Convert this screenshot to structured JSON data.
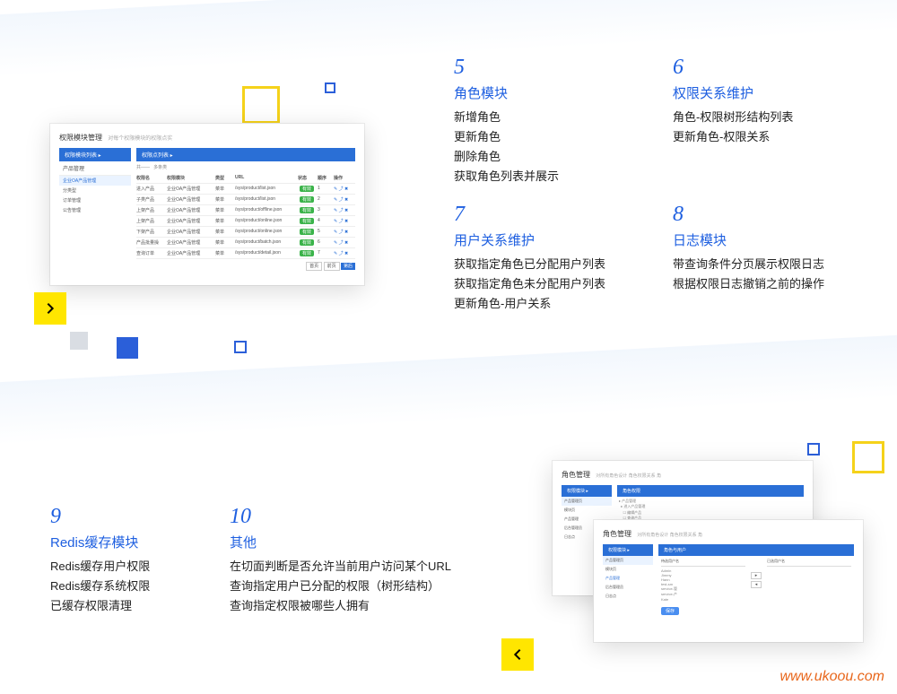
{
  "features": {
    "f5": {
      "num": "5",
      "title": "角色模块",
      "items": [
        "新增角色",
        "更新角色",
        "删除角色",
        "获取角色列表并展示"
      ]
    },
    "f6": {
      "num": "6",
      "title": "权限关系维护",
      "items": [
        "角色-权限树形结构列表",
        "更新角色-权限关系"
      ]
    },
    "f7": {
      "num": "7",
      "title": "用户关系维护",
      "items": [
        "获取指定角色已分配用户列表",
        "获取指定角色未分配用户列表",
        "更新角色-用户关系"
      ]
    },
    "f8": {
      "num": "8",
      "title": "日志模块",
      "items": [
        "带查询条件分页展示权限日志",
        "根据权限日志撤销之前的操作"
      ]
    },
    "f9": {
      "num": "9",
      "title": "Redis缓存模块",
      "items": [
        "Redis缓存用户权限",
        "Redis缓存系统权限",
        "已缓存权限清理"
      ]
    },
    "f10": {
      "num": "10",
      "title": "其他",
      "items": [
        "在切面判断是否允许当前用户访问某个URL",
        "查询指定用户已分配的权限（树形结构）",
        "查询指定权限被哪些人拥有"
      ]
    }
  },
  "mock1": {
    "title": "权限模块管理",
    "subtitle": "对每个权限模块的权限点实",
    "left_header": "权限模块列表",
    "left_sub": "产品管理",
    "left_items": [
      "企业OA产品管理",
      "分类型",
      "订单管理",
      "公告管理"
    ],
    "right_header": "权限点列表",
    "table_head": [
      "权限名",
      "权限模块",
      "类型",
      "URL",
      "状态",
      "顺序",
      "操作"
    ],
    "rows": [
      [
        "进入产品",
        "企业OA产品管理",
        "菜单",
        "/sys/product/list.json"
      ],
      [
        "子类产品",
        "企业OA产品管理",
        "菜单",
        "/sys/product/list.json"
      ],
      [
        "上架产品",
        "企业OA产品管理",
        "菜单",
        "/sys/product/offline.json"
      ],
      [
        "上架产品",
        "企业OA产品管理",
        "菜单",
        "/sys/product/online.json"
      ],
      [
        "下架产品",
        "企业OA产品管理",
        "菜单",
        "/sys/product/online.json"
      ],
      [
        "产品批量操",
        "企业OA产品管理",
        "菜单",
        "/sys/product/batch.json"
      ],
      [
        "查询订单",
        "企业OA产品管理",
        "菜单",
        "/sys/product/detail.json"
      ]
    ],
    "pager": [
      "首页",
      "前页",
      "第后"
    ]
  },
  "mock2": {
    "title": "角色管理",
    "subtitle": "对所有角色设计 角色权限关系 角"
  },
  "watermark": "www.ukoou.com"
}
